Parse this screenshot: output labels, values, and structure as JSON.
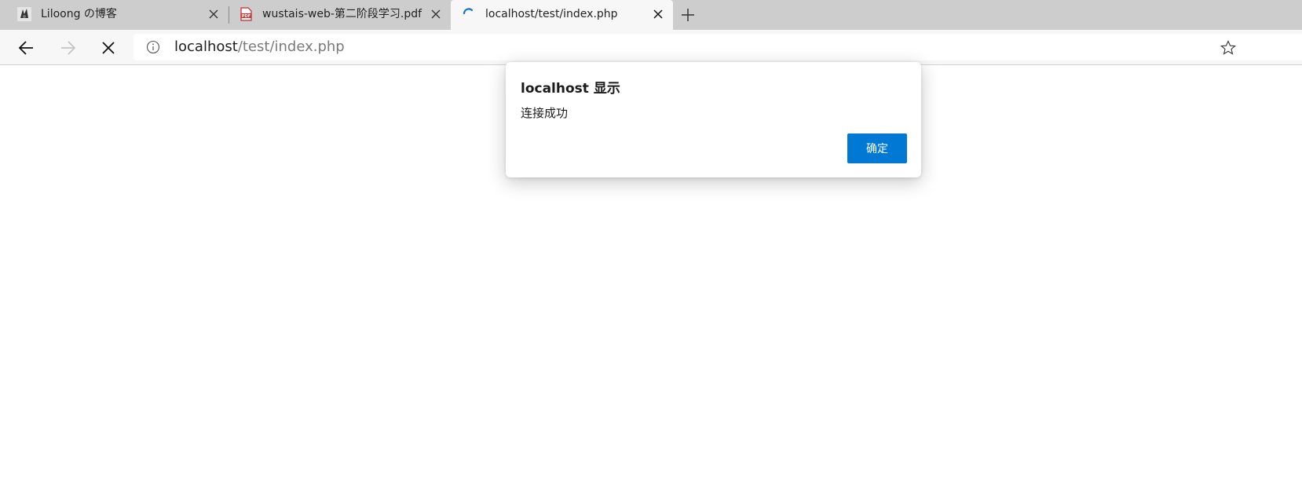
{
  "browser": {
    "tabs": [
      {
        "title": "Liloong の博客",
        "favicon": "liloong-logo-icon",
        "active": false
      },
      {
        "title": "wustais-web-第二阶段学习.pdf",
        "favicon": "pdf-icon",
        "active": false
      },
      {
        "title": "localhost/test/index.php",
        "favicon": "loading-spinner-icon",
        "active": true
      }
    ],
    "address_bar": {
      "host": "localhost",
      "path": "/test/index.php"
    },
    "accent_color": "#0078d4"
  },
  "dialog": {
    "title": "localhost 显示",
    "message": "连接成功",
    "ok_label": "确定"
  }
}
